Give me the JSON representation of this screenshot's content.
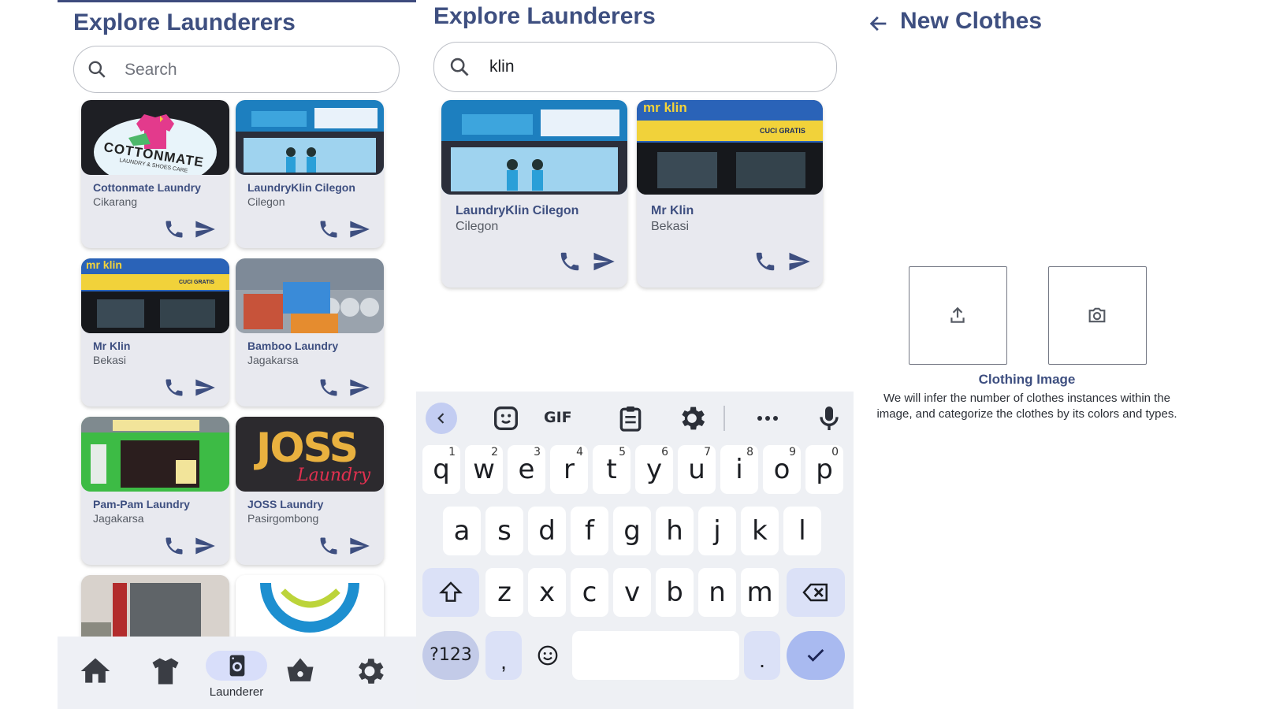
{
  "explore": {
    "title": "Explore Launderers",
    "search_placeholder": "Search",
    "cards": [
      {
        "name": "Cottonmate Laundry",
        "location": "Cikarang"
      },
      {
        "name": "LaundryKlin Cilegon",
        "location": "Cilegon"
      },
      {
        "name": "Mr Klin",
        "location": "Bekasi"
      },
      {
        "name": "Bamboo Laundry",
        "location": "Jagakarsa"
      },
      {
        "name": "Pam-Pam Laundry",
        "location": "Jagakarsa"
      },
      {
        "name": "JOSS Laundry",
        "location": "Pasirgombong"
      }
    ],
    "nav": {
      "active_label": "Launderer"
    }
  },
  "search_view": {
    "title": "Explore Launderers",
    "query": "klin",
    "cards": [
      {
        "name": "LaundryKlin Cilegon",
        "location": "Cilegon"
      },
      {
        "name": "Mr Klin",
        "location": "Bekasi"
      }
    ]
  },
  "logos": {
    "cottonmate": "COTTONMATE",
    "cottonmate_sub": "LAUNDRY & SHOES CARE",
    "mrklin": "mr klin",
    "cuci": "CUCI GRATIS",
    "joss": "JOSS",
    "joss_sub": "Laundry"
  },
  "keyboard": {
    "gif_label": "GIF",
    "row1": [
      "q",
      "w",
      "e",
      "r",
      "t",
      "y",
      "u",
      "i",
      "o",
      "p"
    ],
    "row1_hints": [
      "1",
      "2",
      "3",
      "4",
      "5",
      "6",
      "7",
      "8",
      "9",
      "0"
    ],
    "row2": [
      "a",
      "s",
      "d",
      "f",
      "g",
      "h",
      "j",
      "k",
      "l"
    ],
    "row3": [
      "z",
      "x",
      "c",
      "v",
      "b",
      "n",
      "m"
    ],
    "symbols_label": "?123",
    "comma": ",",
    "period": "."
  },
  "new_clothes": {
    "title": "New Clothes",
    "image_label": "Clothing Image",
    "description": "We will infer the number of clothes instances within the image, and categorize the clothes by its colors and types."
  },
  "colors": {
    "accent": "#3e4f80",
    "card_bg": "#e8e9ef",
    "pill": "#d8defa"
  }
}
